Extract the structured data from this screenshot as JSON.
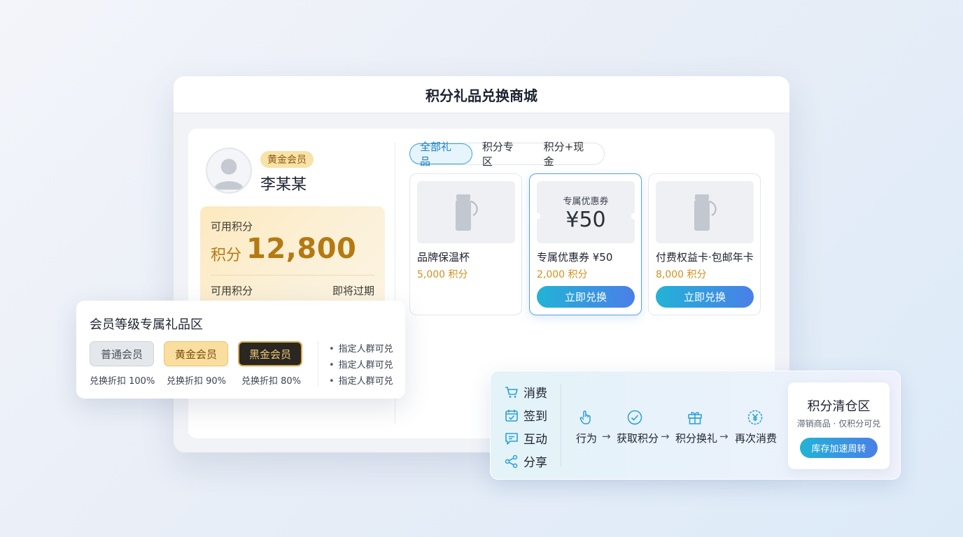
{
  "window": {
    "title": "积分礼品兑换商城"
  },
  "profile": {
    "badge": "黄金会员",
    "name": "李某某",
    "points_card": {
      "label": "可用积分",
      "prefix": "积分",
      "value": "12,800",
      "footer_left": "可用积分",
      "footer_right": "即将过期"
    }
  },
  "tabs": [
    {
      "label": "全部礼品",
      "active": true
    },
    {
      "label": "积分专区",
      "active": false
    },
    {
      "label": "积分+现金",
      "active": false
    }
  ],
  "products": [
    {
      "name": "品牌保温杯",
      "points": "5,000 积分",
      "image": "thermos-icon"
    },
    {
      "name": "专属优惠券 ¥50",
      "points": "2,000 积分",
      "image": "coupon",
      "coupon_title": "专属优惠券",
      "coupon_value": "¥50",
      "button": "立即兑换",
      "selected": true
    },
    {
      "name": "付费权益卡·包邮年卡",
      "points": "8,000 积分",
      "image": "thermos-icon",
      "button": "立即兑换"
    }
  ],
  "tier_zone": {
    "title": "会员等级专属礼品区",
    "tiers": [
      {
        "name": "普通会员",
        "discount": "兑换折扣 100%"
      },
      {
        "name": "黄金会员",
        "discount": "兑换折扣 90%"
      },
      {
        "name": "黑金会员",
        "discount": "兑换折扣 80%"
      }
    ],
    "notes": [
      "指定人群可兑",
      "指定人群可兑",
      "指定人群可兑"
    ]
  },
  "flow": {
    "actions": [
      {
        "label": "消费",
        "icon": "cart-icon"
      },
      {
        "label": "签到",
        "icon": "calendar-check-icon"
      },
      {
        "label": "互动",
        "icon": "chat-icon"
      },
      {
        "label": "分享",
        "icon": "share-icon"
      }
    ],
    "steps": [
      {
        "label": "行为",
        "icon": "tap-hand-icon"
      },
      {
        "label": "获取积分",
        "icon": "check-circle-icon"
      },
      {
        "label": "积分换礼",
        "icon": "gift-icon"
      },
      {
        "label": "再次消费",
        "icon": "yen-circle-icon"
      }
    ],
    "arrow": "→",
    "clearance": {
      "title": "积分清仓区",
      "subtitle": "滞销商品 · 仅积分可兑",
      "button": "库存加速周转"
    }
  },
  "colors": {
    "accent": "#2b9fd6",
    "gold": "#b57912",
    "points": "#d0911e"
  }
}
